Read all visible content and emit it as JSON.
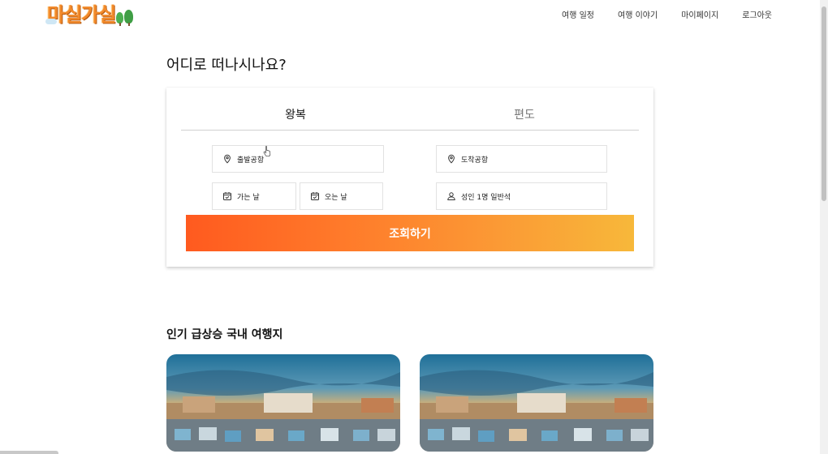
{
  "header": {
    "logo_text": "마실가실",
    "nav": [
      "여행 일정",
      "여행 이야기",
      "마이페이지",
      "로그아웃"
    ]
  },
  "search": {
    "title": "어디로 떠나시나요?",
    "tabs": [
      {
        "label": "왕복",
        "active": true
      },
      {
        "label": "편도",
        "active": false
      }
    ],
    "departure": "출발공항",
    "arrival": "도착공항",
    "go_date": "가는 날",
    "return_date": "오는 날",
    "passengers": "성인 1명 일반석",
    "submit": "조회하기"
  },
  "popular": {
    "title": "인기 급상승 국내 여행지"
  },
  "colors": {
    "accent_start": "#ff5a1f",
    "accent_end": "#f7b83a",
    "logo": "#f28a2b"
  }
}
